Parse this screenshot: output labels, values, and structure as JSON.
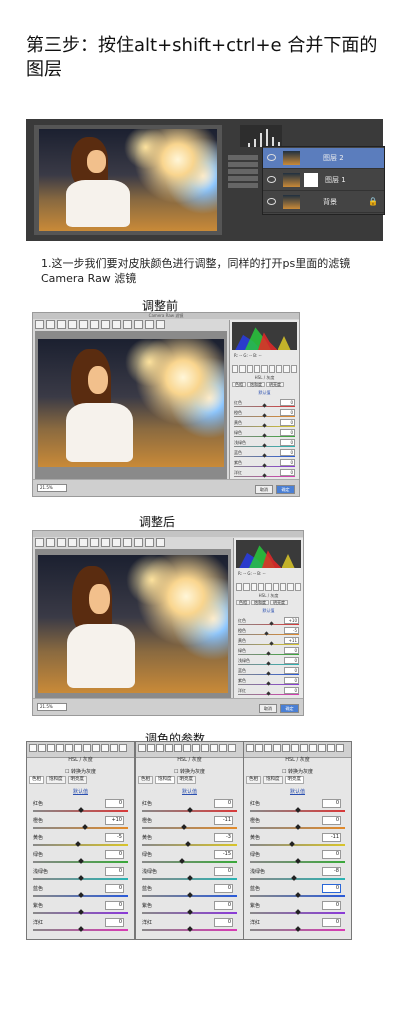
{
  "header": {
    "title": "第三步：按住alt+shift+ctrl+e 合并下面的图层"
  },
  "photoshop": {
    "layers": [
      {
        "name": "图层 2",
        "selected": true
      },
      {
        "name": "图层 1",
        "selected": false
      },
      {
        "name": "背景",
        "selected": false,
        "lock": "🔒"
      }
    ]
  },
  "step": {
    "text": "1.这一步我们要对皮肤颜色进行调整，同样的打开ps里面的滤镜Camera Raw 滤镜"
  },
  "captions": {
    "before": "调整前",
    "after": "调整后",
    "params": "调色的参数"
  },
  "colors": {
    "red": "#d83a3a",
    "orange": "#e28a2a",
    "yellow": "#d8c42a",
    "green": "#3aa83a",
    "aqua": "#2ab4b4",
    "blue": "#2a5ad8",
    "purple": "#8a3ad8",
    "magenta": "#d83ab4",
    "selection": "#5b7dbd",
    "accent": "#4a7fd4"
  },
  "camera_raw": {
    "title_before": "Camera Raw 滤镜",
    "panel_section": "HSL / 灰度",
    "info_left": "f/--  --秒\nISO --  --毫米",
    "info_right": "R:  --  G:  --  B:  --",
    "zoom": "21.5%",
    "cancel": "取消",
    "ok": "确定",
    "hue_label": "色相",
    "sliders_before": [
      {
        "label": "红色",
        "value": "0"
      },
      {
        "label": "橙色",
        "value": "0"
      },
      {
        "label": "黄色",
        "value": "0"
      },
      {
        "label": "绿色",
        "value": "0"
      },
      {
        "label": "浅绿色",
        "value": "0"
      },
      {
        "label": "蓝色",
        "value": "0"
      },
      {
        "label": "紫色",
        "value": "0"
      },
      {
        "label": "洋红",
        "value": "0"
      }
    ],
    "sliders_after": [
      {
        "label": "红色",
        "value": "+10"
      },
      {
        "label": "橙色",
        "value": "-5"
      },
      {
        "label": "黄色",
        "value": "+11"
      },
      {
        "label": "绿色",
        "value": "0"
      },
      {
        "label": "浅绿色",
        "value": "0"
      },
      {
        "label": "蓝色",
        "value": "0"
      },
      {
        "label": "紫色",
        "value": "0"
      },
      {
        "label": "洋红",
        "value": "0"
      }
    ]
  },
  "param_panels": [
    {
      "head": "HSL / 灰度",
      "mono": "转换为灰度",
      "tabs": [
        "色相",
        "饱和度",
        "明亮度"
      ],
      "active_tab": 0,
      "default": "默认值",
      "sliders": [
        {
          "label": "红色",
          "value": "0"
        },
        {
          "label": "橙色",
          "value": "+10"
        },
        {
          "label": "黄色",
          "value": "-5"
        },
        {
          "label": "绿色",
          "value": "0"
        },
        {
          "label": "浅绿色",
          "value": "0"
        },
        {
          "label": "蓝色",
          "value": "0"
        },
        {
          "label": "紫色",
          "value": "0"
        },
        {
          "label": "洋红",
          "value": "0"
        }
      ]
    },
    {
      "head": "HSL / 灰度",
      "mono": "转换为灰度",
      "tabs": [
        "色相",
        "饱和度",
        "明亮度"
      ],
      "active_tab": 1,
      "default": "默认值",
      "sliders": [
        {
          "label": "红色",
          "value": "0"
        },
        {
          "label": "橙色",
          "value": "-11"
        },
        {
          "label": "黄色",
          "value": "-3"
        },
        {
          "label": "绿色",
          "value": "-15"
        },
        {
          "label": "浅绿色",
          "value": "0"
        },
        {
          "label": "蓝色",
          "value": "0"
        },
        {
          "label": "紫色",
          "value": "0"
        },
        {
          "label": "洋红",
          "value": "0"
        }
      ]
    },
    {
      "head": "HSL / 灰度",
      "mono": "转换为灰度",
      "tabs": [
        "色相",
        "饱和度",
        "明亮度"
      ],
      "active_tab": 2,
      "default": "默认值",
      "sliders": [
        {
          "label": "红色",
          "value": "0"
        },
        {
          "label": "橙色",
          "value": "0"
        },
        {
          "label": "黄色",
          "value": "-11"
        },
        {
          "label": "绿色",
          "value": "0"
        },
        {
          "label": "浅绿色",
          "value": "-8"
        },
        {
          "label": "蓝色",
          "value": "0"
        },
        {
          "label": "紫色",
          "value": "0"
        },
        {
          "label": "洋红",
          "value": "0"
        }
      ]
    }
  ]
}
